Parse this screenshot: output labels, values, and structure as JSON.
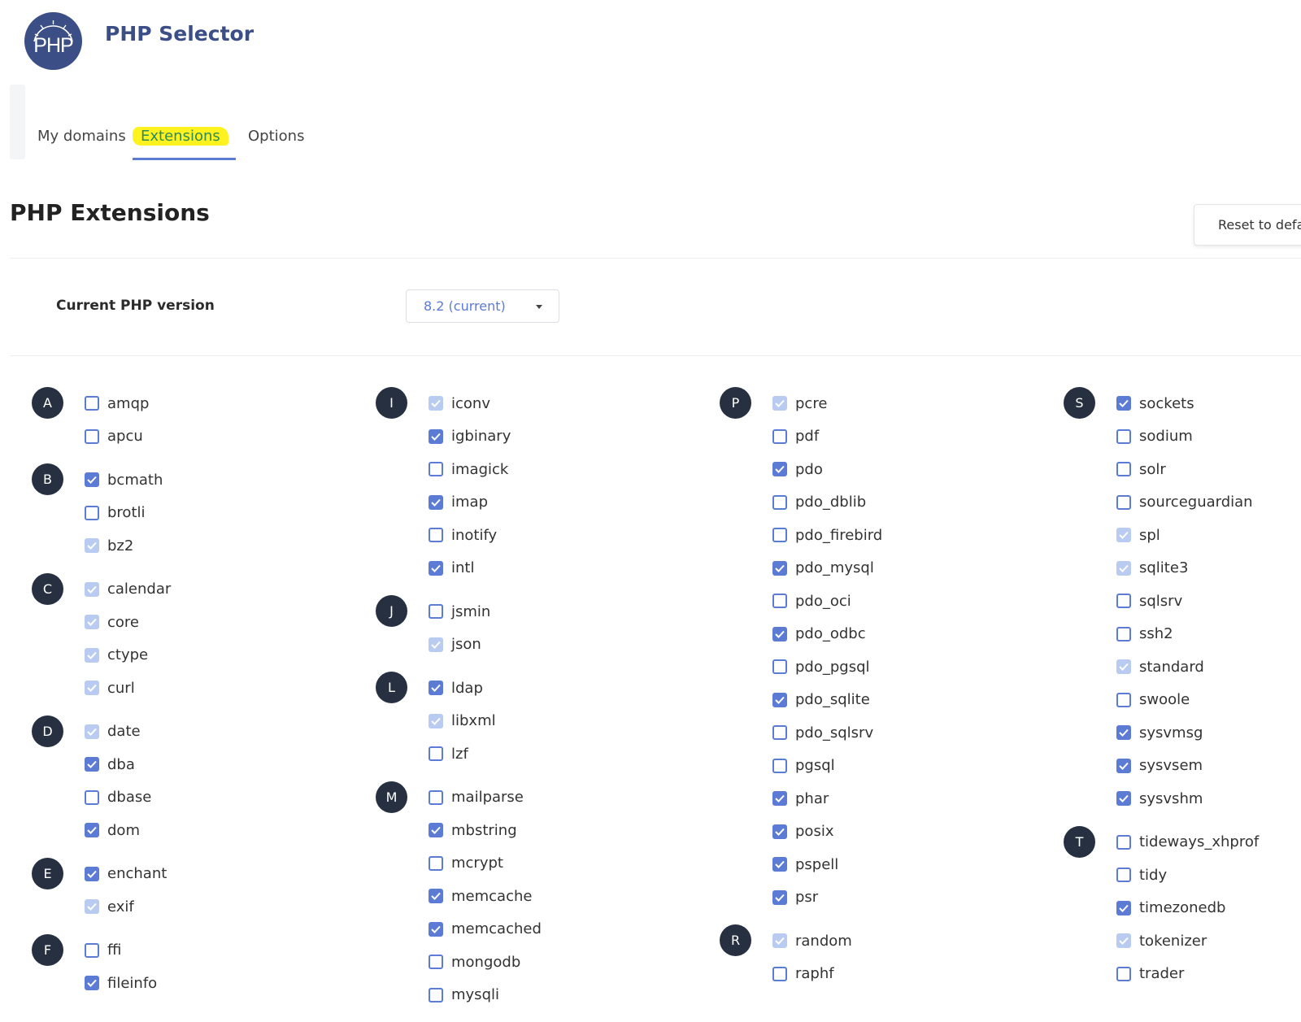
{
  "app": {
    "logo_text": "PHP",
    "title": "PHP Selector"
  },
  "tabs": [
    {
      "label": "My domains"
    },
    {
      "label": "Extensions",
      "active": true
    },
    {
      "label": "Options"
    }
  ],
  "page": {
    "heading": "PHP Extensions",
    "reset_label": "Reset to default"
  },
  "version": {
    "label": "Current PHP version",
    "value": "8.2 (current)"
  },
  "colors": {
    "accent": "#5b7bd5",
    "disabled": "#b9cbf0",
    "letter_bg": "#263040",
    "brand": "#3b4f86",
    "highlight": "#fff21f"
  },
  "columns": [
    {
      "groups": [
        {
          "letter": "A",
          "items": [
            {
              "name": "amqp",
              "state": "unchecked"
            },
            {
              "name": "apcu",
              "state": "unchecked"
            }
          ]
        },
        {
          "letter": "B",
          "items": [
            {
              "name": "bcmath",
              "state": "checked"
            },
            {
              "name": "brotli",
              "state": "unchecked"
            },
            {
              "name": "bz2",
              "state": "disabled"
            }
          ]
        },
        {
          "letter": "C",
          "items": [
            {
              "name": "calendar",
              "state": "disabled"
            },
            {
              "name": "core",
              "state": "disabled"
            },
            {
              "name": "ctype",
              "state": "disabled"
            },
            {
              "name": "curl",
              "state": "disabled"
            }
          ]
        },
        {
          "letter": "D",
          "items": [
            {
              "name": "date",
              "state": "disabled"
            },
            {
              "name": "dba",
              "state": "checked"
            },
            {
              "name": "dbase",
              "state": "unchecked"
            },
            {
              "name": "dom",
              "state": "checked"
            }
          ]
        },
        {
          "letter": "E",
          "items": [
            {
              "name": "enchant",
              "state": "checked"
            },
            {
              "name": "exif",
              "state": "disabled"
            }
          ]
        },
        {
          "letter": "F",
          "items": [
            {
              "name": "ffi",
              "state": "unchecked"
            },
            {
              "name": "fileinfo",
              "state": "checked"
            }
          ]
        }
      ]
    },
    {
      "groups": [
        {
          "letter": "I",
          "items": [
            {
              "name": "iconv",
              "state": "disabled"
            },
            {
              "name": "igbinary",
              "state": "checked"
            },
            {
              "name": "imagick",
              "state": "unchecked"
            },
            {
              "name": "imap",
              "state": "checked"
            },
            {
              "name": "inotify",
              "state": "unchecked"
            },
            {
              "name": "intl",
              "state": "checked"
            }
          ]
        },
        {
          "letter": "J",
          "items": [
            {
              "name": "jsmin",
              "state": "unchecked"
            },
            {
              "name": "json",
              "state": "disabled"
            }
          ]
        },
        {
          "letter": "L",
          "items": [
            {
              "name": "ldap",
              "state": "checked"
            },
            {
              "name": "libxml",
              "state": "disabled"
            },
            {
              "name": "lzf",
              "state": "unchecked"
            }
          ]
        },
        {
          "letter": "M",
          "items": [
            {
              "name": "mailparse",
              "state": "unchecked"
            },
            {
              "name": "mbstring",
              "state": "checked"
            },
            {
              "name": "mcrypt",
              "state": "unchecked"
            },
            {
              "name": "memcache",
              "state": "checked"
            },
            {
              "name": "memcached",
              "state": "checked"
            },
            {
              "name": "mongodb",
              "state": "unchecked"
            },
            {
              "name": "mysqli",
              "state": "unchecked"
            }
          ]
        }
      ]
    },
    {
      "groups": [
        {
          "letter": "P",
          "items": [
            {
              "name": "pcre",
              "state": "disabled"
            },
            {
              "name": "pdf",
              "state": "unchecked"
            },
            {
              "name": "pdo",
              "state": "checked"
            },
            {
              "name": "pdo_dblib",
              "state": "unchecked"
            },
            {
              "name": "pdo_firebird",
              "state": "unchecked"
            },
            {
              "name": "pdo_mysql",
              "state": "checked"
            },
            {
              "name": "pdo_oci",
              "state": "unchecked"
            },
            {
              "name": "pdo_odbc",
              "state": "checked"
            },
            {
              "name": "pdo_pgsql",
              "state": "unchecked"
            },
            {
              "name": "pdo_sqlite",
              "state": "checked"
            },
            {
              "name": "pdo_sqlsrv",
              "state": "unchecked"
            },
            {
              "name": "pgsql",
              "state": "unchecked"
            },
            {
              "name": "phar",
              "state": "checked"
            },
            {
              "name": "posix",
              "state": "checked"
            },
            {
              "name": "pspell",
              "state": "checked"
            },
            {
              "name": "psr",
              "state": "checked"
            }
          ]
        },
        {
          "letter": "R",
          "items": [
            {
              "name": "random",
              "state": "disabled"
            },
            {
              "name": "raphf",
              "state": "unchecked"
            }
          ]
        }
      ]
    },
    {
      "groups": [
        {
          "letter": "S",
          "items": [
            {
              "name": "sockets",
              "state": "checked"
            },
            {
              "name": "sodium",
              "state": "unchecked"
            },
            {
              "name": "solr",
              "state": "unchecked"
            },
            {
              "name": "sourceguardian",
              "state": "unchecked"
            },
            {
              "name": "spl",
              "state": "disabled"
            },
            {
              "name": "sqlite3",
              "state": "disabled"
            },
            {
              "name": "sqlsrv",
              "state": "unchecked"
            },
            {
              "name": "ssh2",
              "state": "unchecked"
            },
            {
              "name": "standard",
              "state": "disabled"
            },
            {
              "name": "swoole",
              "state": "unchecked"
            },
            {
              "name": "sysvmsg",
              "state": "checked"
            },
            {
              "name": "sysvsem",
              "state": "checked"
            },
            {
              "name": "sysvshm",
              "state": "checked"
            }
          ]
        },
        {
          "letter": "T",
          "items": [
            {
              "name": "tideways_xhprof",
              "state": "unchecked"
            },
            {
              "name": "tidy",
              "state": "unchecked"
            },
            {
              "name": "timezonedb",
              "state": "checked"
            },
            {
              "name": "tokenizer",
              "state": "disabled"
            },
            {
              "name": "trader",
              "state": "unchecked"
            }
          ]
        }
      ]
    }
  ]
}
